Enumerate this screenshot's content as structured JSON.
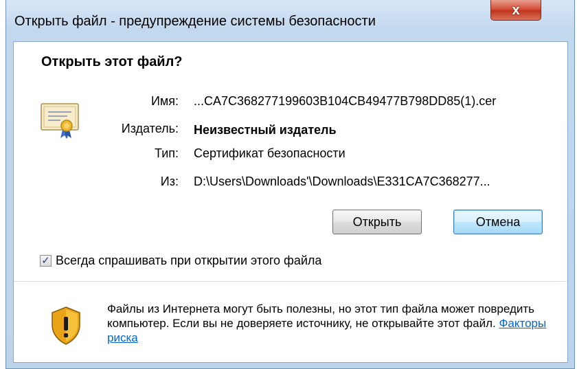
{
  "window": {
    "title": "Открыть файл - предупреждение системы безопасности",
    "close_label": "x"
  },
  "dialog": {
    "heading": "Открыть этот файл?",
    "fields": {
      "name_label": "Имя:",
      "name_value": "...CA7C368277199603B104CB49477B798DD85(1).cer",
      "publisher_label": "Издатель:",
      "publisher_value": "Неизвестный издатель",
      "type_label": "Тип:",
      "type_value": "Сертификат безопасности",
      "from_label": "Из:",
      "from_value": "D:\\Users\\Downloads'\\Downloads\\E331CA7C368277..."
    },
    "buttons": {
      "open_label": "Открыть",
      "cancel_label": "Отмена"
    },
    "checkbox": {
      "label": "Всегда спрашивать при открытии этого файла",
      "checked": true
    },
    "warning": {
      "text": "Файлы из Интернета могут быть полезны, но этот тип файла может повредить компьютер. Если вы не доверяете источнику, не открывайте этот файл. ",
      "link_label": "Факторы риска"
    }
  },
  "icons": [
    "certificate-icon",
    "shield-warning-icon",
    "close-icon",
    "checkmark-icon"
  ],
  "colors": {
    "link": "#0066cc",
    "close_button": "#c2351f",
    "frame": "#bcd3ec",
    "default_button_border": "#3c7fb1"
  }
}
